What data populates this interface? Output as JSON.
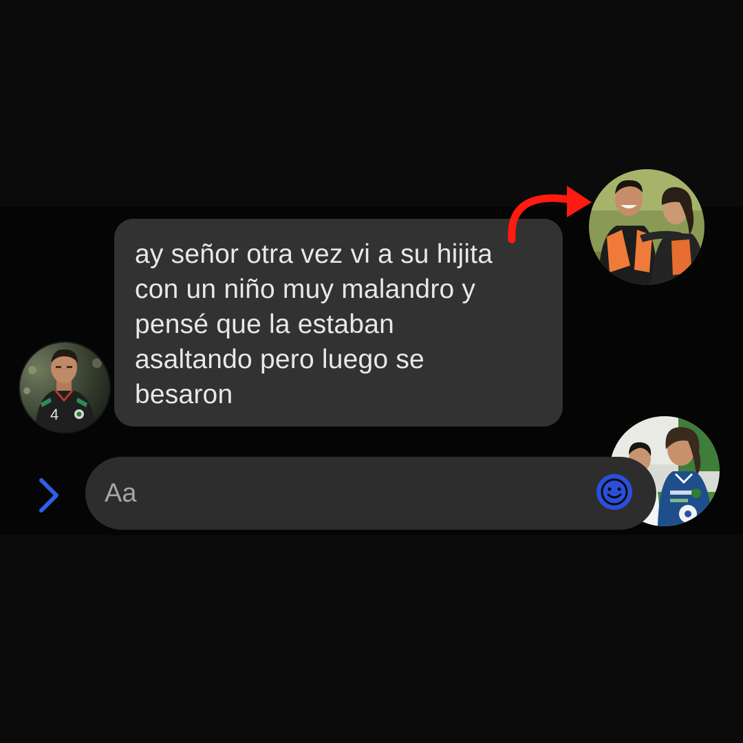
{
  "conversation": {
    "message": "ay señor otra vez vi a su hijita\ncon un niño muy malandro y\npensé que la estaban\nasaltando pero luego se\nbesaron"
  },
  "composer": {
    "placeholder": "Aa"
  },
  "icons": {
    "expand": "chevron-right-icon",
    "emoji": "emoji-icon",
    "annotation": "curved-arrow-icon"
  },
  "colors": {
    "background": "#0b0b0b",
    "bubble": "#323232",
    "composer": "#2d2d2d",
    "accent": "#1f5fff",
    "arrow": "#ff1a12",
    "text": "#e8e8e8",
    "placeholder": "#a6a6a6"
  },
  "avatars": {
    "sender_jersey_number": "4"
  }
}
